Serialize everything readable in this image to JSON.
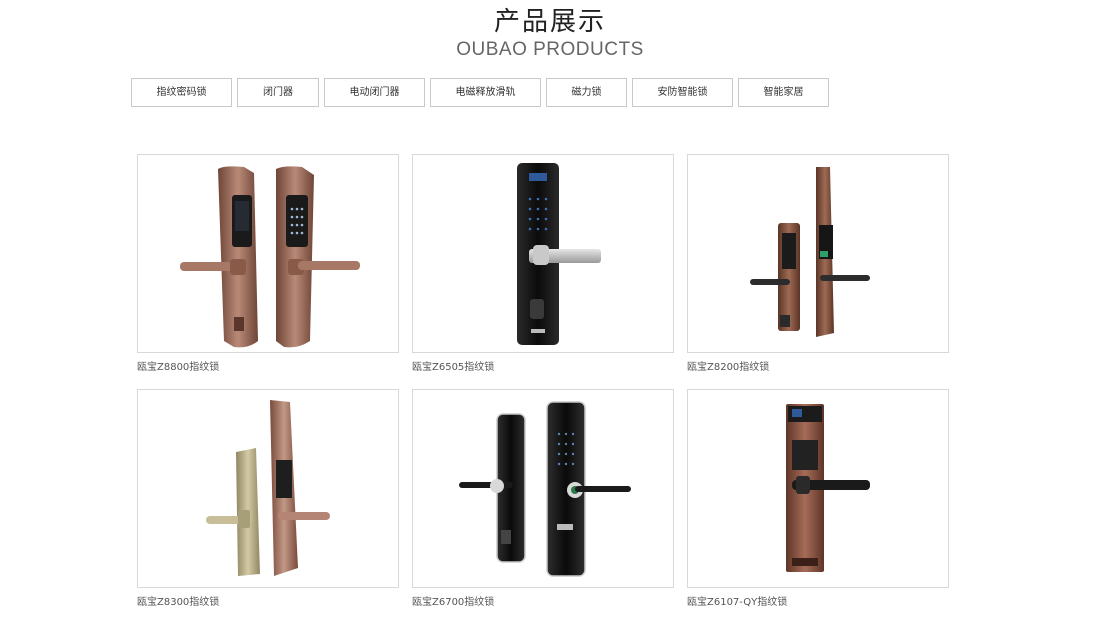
{
  "heading": {
    "title_cn": "产品展示",
    "title_en": "OUBAO PRODUCTS"
  },
  "categories": [
    {
      "label": "指纹密码锁"
    },
    {
      "label": "闭门器"
    },
    {
      "label": "电动闭门器"
    },
    {
      "label": "电磁释放滑轨"
    },
    {
      "label": "磁力锁"
    },
    {
      "label": "安防智能锁"
    },
    {
      "label": "智能家居"
    }
  ],
  "products": [
    {
      "name": "瓯宝Z8800指纹锁",
      "finish": "rose-bronze",
      "image": "lock-pair-icon"
    },
    {
      "name": "瓯宝Z6505指纹锁",
      "finish": "black-glass",
      "image": "lock-single-icon"
    },
    {
      "name": "瓯宝Z8200指纹锁",
      "finish": "bronze",
      "image": "lock-pair-icon"
    },
    {
      "name": "瓯宝Z8300指纹锁",
      "finish": "champagne-gold",
      "image": "lock-pair-icon"
    },
    {
      "name": "瓯宝Z6700指纹锁",
      "finish": "black-glass",
      "image": "lock-pair-icon"
    },
    {
      "name": "瓯宝Z6107-QY指纹锁",
      "finish": "red-bronze",
      "image": "lock-single-icon"
    }
  ],
  "colors": {
    "border": "#d8d8d8",
    "tab_border": "#c9c9c9",
    "bronze": "#8a5a48",
    "bronze_light": "#b98a78",
    "black_glass": "#141414",
    "gold": "#b7ad86",
    "copper": "#7a4a3a"
  }
}
